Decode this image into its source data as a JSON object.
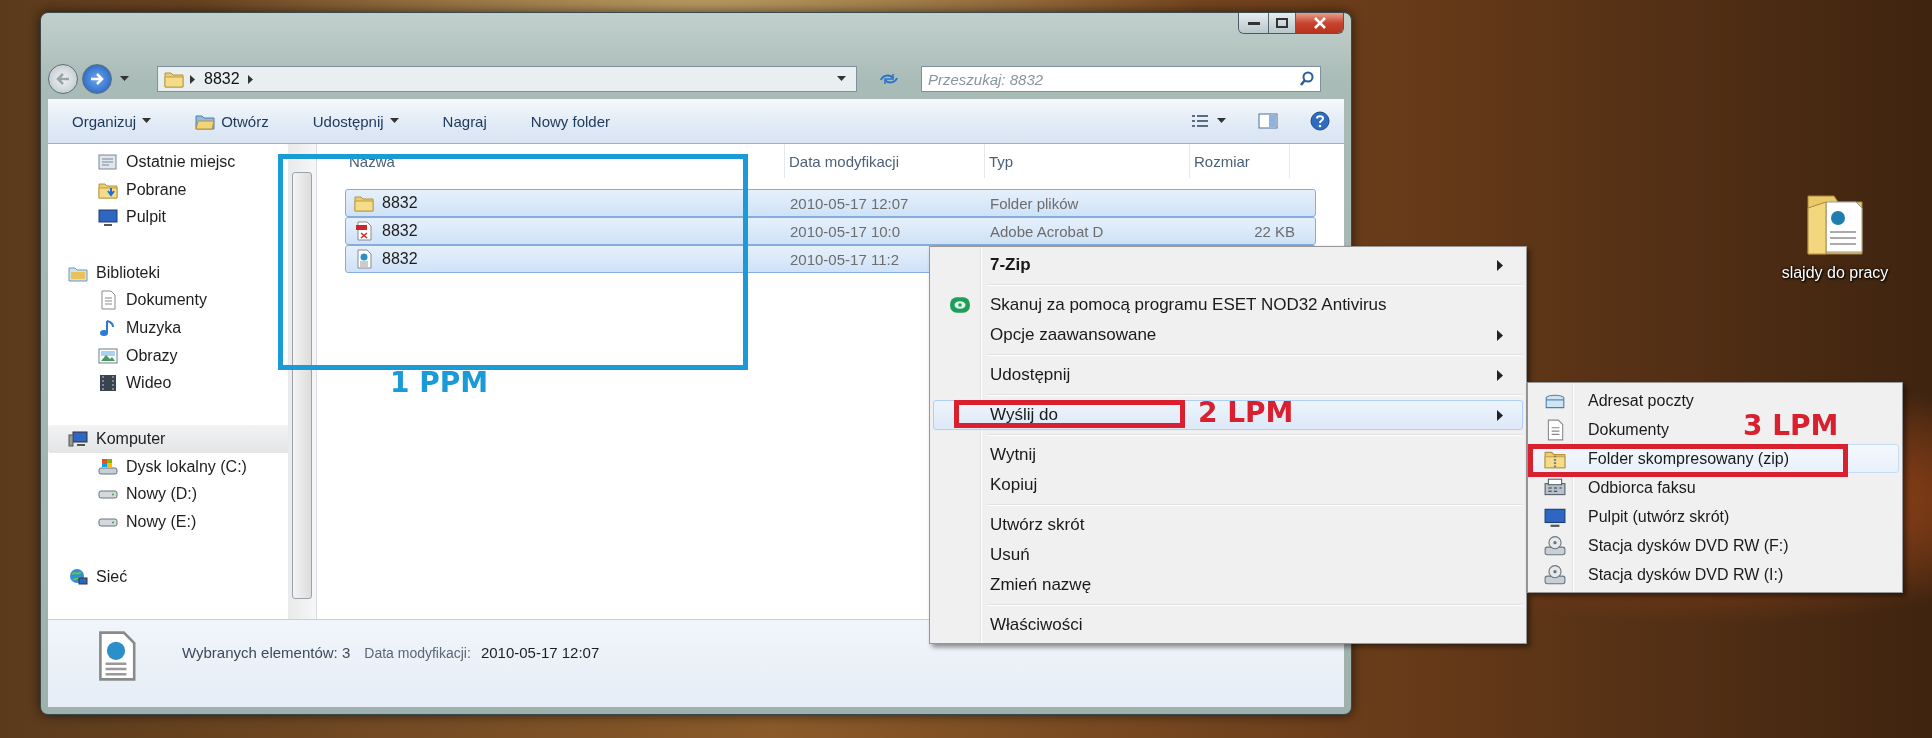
{
  "address": {
    "path": "8832",
    "search_placeholder": "Przeszukaj: 8832"
  },
  "toolbar": [
    {
      "label": "Organizuj",
      "kind": "plain",
      "dropdown": true
    },
    {
      "label": "Otwórz",
      "kind": "open",
      "dropdown": false
    },
    {
      "label": "Udostępnij",
      "kind": "plain",
      "dropdown": true
    },
    {
      "label": "Nagraj",
      "kind": "plain",
      "dropdown": false
    },
    {
      "label": "Nowy folder",
      "kind": "plain",
      "dropdown": false
    }
  ],
  "navigation": [
    {
      "children": [
        {
          "label": "Ostatnie miejsc",
          "kind": "recent",
          "selected": false
        },
        {
          "label": "Pobrane",
          "kind": "downloads",
          "selected": false
        },
        {
          "label": "Pulpit",
          "kind": "monitor",
          "selected": false
        }
      ]
    },
    {
      "label": "Biblioteki",
      "kind": "library",
      "selected": false,
      "children": [
        {
          "label": "Dokumenty",
          "kind": "documents",
          "selected": false
        },
        {
          "label": "Muzyka",
          "kind": "music",
          "selected": false
        },
        {
          "label": "Obrazy",
          "kind": "pictures",
          "selected": false
        },
        {
          "label": "Wideo",
          "kind": "video",
          "selected": false
        }
      ]
    },
    {
      "label": "Komputer",
      "kind": "computer",
      "selected": true,
      "children": [
        {
          "label": "Dysk lokalny (C:)",
          "kind": "drivec",
          "selected": false
        },
        {
          "label": "Nowy (D:)",
          "kind": "drive",
          "selected": false
        },
        {
          "label": "Nowy (E:)",
          "kind": "drive",
          "selected": false
        }
      ]
    },
    {
      "label": "Sieć",
      "kind": "network",
      "selected": false
    }
  ],
  "files": {
    "columns": [
      "Nazwa",
      "Data modyfikacji",
      "Typ",
      "Rozmiar"
    ],
    "rows": [
      {
        "name": "8832",
        "kind": "folder",
        "date": "2010-05-17 12:07",
        "type": "Folder plików",
        "selected": true
      },
      {
        "name": "8832",
        "kind": "pdf",
        "date": "2010-05-17 10:0",
        "type": "Adobe Acrobat D",
        "size": "22 KB",
        "selected": true
      },
      {
        "name": "8832",
        "kind": "html",
        "date": "2010-05-17 11:2",
        "selected": true
      }
    ]
  },
  "status": {
    "count": "Wybranych elementów: 3",
    "date_label": "Data modyfikacji:",
    "date": "2010-05-17 12:07"
  },
  "context_menu": [
    {
      "kind": "submenu",
      "label": "7-Zip",
      "bold": true,
      "selected": false
    },
    {
      "kind": "separator"
    },
    {
      "kind": "antivirus",
      "label": "Skanuj za pomocą programu ESET NOD32 Antivirus",
      "bold": false,
      "selected": false
    },
    {
      "kind": "submenu",
      "label": "Opcje zaawansowane",
      "bold": false,
      "selected": false
    },
    {
      "kind": "separator"
    },
    {
      "kind": "submenu",
      "label": "Udostępnij",
      "bold": false,
      "selected": false
    },
    {
      "kind": "separator"
    },
    {
      "kind": "submenu",
      "label": "Wyślij do",
      "bold": false,
      "selected": true
    },
    {
      "kind": "separator"
    },
    {
      "kind": "command",
      "label": "Wytnij",
      "bold": false,
      "selected": false
    },
    {
      "kind": "command",
      "label": "Kopiuj",
      "bold": false,
      "selected": false
    },
    {
      "kind": "separator"
    },
    {
      "kind": "command",
      "label": "Utwórz skrót",
      "bold": false,
      "selected": false
    },
    {
      "kind": "command",
      "label": "Usuń",
      "bold": false,
      "selected": false
    },
    {
      "kind": "command",
      "label": "Zmień nazwę",
      "bold": false,
      "selected": false
    },
    {
      "kind": "separator"
    },
    {
      "kind": "command",
      "label": "Właściwości",
      "bold": false,
      "selected": false
    }
  ],
  "send_to_menu": [
    {
      "kind": "mail",
      "label": "Adresat poczty",
      "selected": false
    },
    {
      "kind": "documents",
      "label": "Dokumenty",
      "selected": false
    },
    {
      "kind": "zip",
      "label": "Folder skompresowany (zip)",
      "selected": true
    },
    {
      "kind": "fax",
      "label": "Odbiorca faksu",
      "selected": false
    },
    {
      "kind": "monitor",
      "label": "Pulpit (utwórz skrót)",
      "selected": false
    },
    {
      "kind": "dvd",
      "label": "Stacja dysków DVD RW (F:)",
      "selected": false
    },
    {
      "kind": "dvd",
      "label": "Stacja dysków DVD RW (I:)",
      "selected": false
    }
  ],
  "annotations": [
    {
      "label": "1 PPM",
      "color": "#1a9ad6"
    },
    {
      "label": "2 LPM",
      "color": "#d8202e"
    },
    {
      "label": "3 LPM",
      "color": "#d8202e"
    }
  ],
  "desktop_icons": [
    {
      "label": "slajdy do pracy"
    }
  ]
}
